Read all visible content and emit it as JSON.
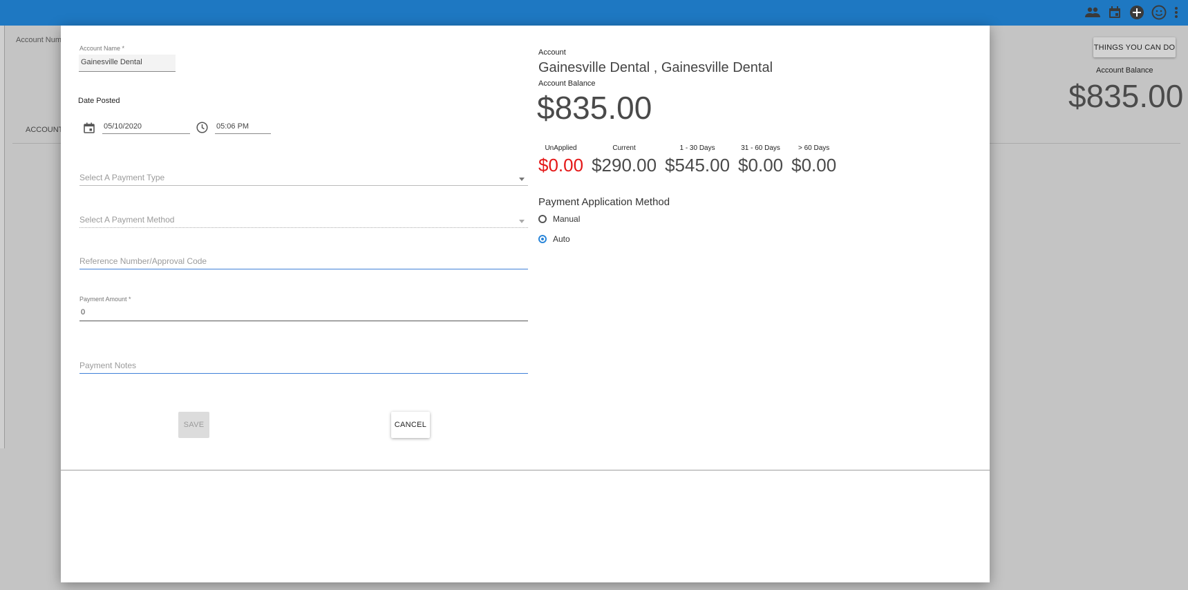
{
  "topbar": {
    "icons": [
      "people-icon",
      "calendar-icon",
      "add-circle-icon",
      "smiley-icon",
      "more-vert-icon"
    ],
    "color": "#1e78c2"
  },
  "background": {
    "account_num_label": "Account Num",
    "account_tab_label": "ACCOUNT",
    "things_button": "THINGS YOU CAN DO",
    "balance_label": "Account Balance",
    "balance_value": "$835.00"
  },
  "form": {
    "account_name_label": "Account Name *",
    "account_name_value": "Gainesville Dental",
    "date_posted_label": "Date Posted",
    "date_value": "05/10/2020",
    "time_value": "05:06 PM",
    "payment_type_placeholder": "Select A Payment Type",
    "payment_method_placeholder": "Select A Payment Method",
    "reference_placeholder": "Reference Number/Approval Code",
    "payment_amount_label": "Payment Amount *",
    "payment_amount_value": "0",
    "payment_notes_placeholder": "Payment Notes",
    "save_label": "SAVE",
    "cancel_label": "CANCEL"
  },
  "summary": {
    "account_label": "Account",
    "account_title": "Gainesville Dental , Gainesville Dental",
    "balance_label": "Account Balance",
    "balance_value": "$835.00",
    "aging": [
      {
        "head": "UnApplied",
        "amount": "$0.00",
        "color": "#e41818"
      },
      {
        "head": "Current",
        "amount": "$290.00"
      },
      {
        "head": "1 - 30 Days",
        "amount": "$545.00"
      },
      {
        "head": "31 - 60 Days",
        "amount": "$0.00"
      },
      {
        "head": "> 60 Days",
        "amount": "$0.00"
      }
    ],
    "pam_title": "Payment Application Method",
    "options": [
      {
        "label": "Manual",
        "selected": false
      },
      {
        "label": "Auto",
        "selected": true
      }
    ]
  }
}
